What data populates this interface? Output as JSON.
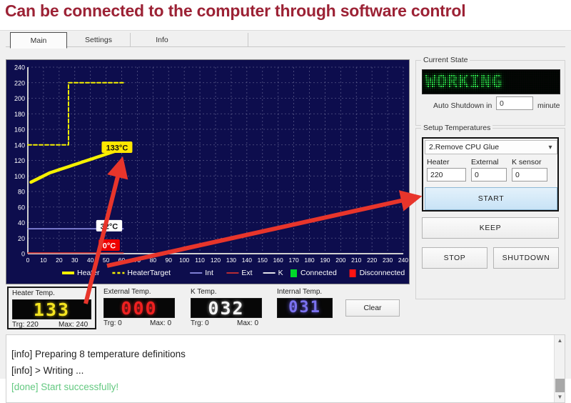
{
  "banner": {
    "text": "Can be connected to the computer through software control"
  },
  "tabs": [
    {
      "label": "Main",
      "selected": true
    },
    {
      "label": "Settings",
      "selected": false
    },
    {
      "label": "Info",
      "selected": false
    },
    {
      "label": "",
      "selected": false
    }
  ],
  "current_state": {
    "title": "Current State",
    "status_text": "WORKING",
    "status_color": "#2ce24a",
    "auto_shutdown_label": "Auto Shutdown in",
    "auto_shutdown_value": "0",
    "auto_shutdown_unit": "minute"
  },
  "setup": {
    "title": "Setup Temperatures",
    "profile_selected": "2.Remove CPU Glue",
    "chevron": "chevron-down-icon",
    "fields": [
      {
        "label": "Heater",
        "value": "220"
      },
      {
        "label": "External",
        "value": "0"
      },
      {
        "label": "K sensor",
        "value": "0"
      }
    ],
    "start_label": "START",
    "keep_label": "KEEP",
    "stop_label": "STOP",
    "shutdown_label": "SHUTDOWN"
  },
  "readouts": [
    {
      "caption": "Heater Temp.",
      "value": "133",
      "color": "#f4e420",
      "trg": "Trg: 220",
      "max": "Max: 240",
      "highlighted": true
    },
    {
      "caption": "External Temp.",
      "value": "000",
      "color": "#f02020",
      "trg": "Trg: 0",
      "max": "Max: 0",
      "highlighted": false
    },
    {
      "caption": "K Temp.",
      "value": "032",
      "color": "#f4f4f4",
      "trg": "Trg: 0",
      "max": "Max: 0",
      "highlighted": false
    },
    {
      "caption": "Internal Temp.",
      "value": "031",
      "color": "#7b72f0",
      "trg": "",
      "max": "",
      "highlighted": false
    }
  ],
  "clear_button": {
    "label": "Clear"
  },
  "log": {
    "lines": [
      {
        "text": "[info] Preparing 8 temperature definitions",
        "color": "#1f1f1f"
      },
      {
        "text": "[info] > Writing ...",
        "color": "#1f1f1f"
      },
      {
        "text": "[done] Start successfully!",
        "color": "#64c981"
      }
    ]
  },
  "chart_data": {
    "type": "line",
    "title": "",
    "xlabel": "",
    "ylabel": "",
    "xlim": [
      0,
      240
    ],
    "ylim": [
      0,
      240
    ],
    "xticks": [
      0,
      10,
      20,
      30,
      40,
      50,
      60,
      70,
      80,
      90,
      100,
      110,
      120,
      130,
      140,
      150,
      160,
      170,
      180,
      190,
      200,
      210,
      220,
      230,
      240
    ],
    "yticks": [
      0,
      20,
      40,
      60,
      80,
      100,
      120,
      140,
      160,
      180,
      200,
      220,
      240
    ],
    "grid": true,
    "background": "#0d0d4d",
    "grid_color": "#6f6f9a",
    "axis_color": "#cfcfcf",
    "legend_position": "bottom",
    "legend": [
      {
        "name": "Heater",
        "color": "#f5f000",
        "style": "solid-thick"
      },
      {
        "name": "HeaterTarget",
        "color": "#f5f000",
        "style": "dashed"
      },
      {
        "name": "Int",
        "color": "#8f8fe8",
        "style": "solid"
      },
      {
        "name": "Ext",
        "color": "#cf3030",
        "style": "solid"
      },
      {
        "name": "K",
        "color": "#ffffff",
        "style": "solid"
      },
      {
        "name": "Connected",
        "color": "#00d82a",
        "style": "swatch"
      },
      {
        "name": "Disconnected",
        "color": "#ff1414",
        "style": "swatch"
      }
    ],
    "annotations": [
      {
        "text": "133°C",
        "x": 57,
        "y": 137,
        "bg": "#ffe800",
        "fg": "#111111"
      },
      {
        "text": "32°C",
        "x": 52,
        "y": 36,
        "bg": "#ffffff",
        "fg": "#111111"
      },
      {
        "text": "0°C",
        "x": 52,
        "y": 11,
        "bg": "#ee0000",
        "fg": "#ffffff"
      }
    ],
    "series": [
      {
        "name": "Heater",
        "color": "#f5f000",
        "style": "solid-thick",
        "x": [
          2,
          5,
          8,
          11,
          14,
          17,
          20,
          23,
          26,
          29,
          32,
          35,
          38,
          41,
          44,
          47,
          50,
          53,
          56,
          59,
          61
        ],
        "y": [
          92,
          95,
          98,
          101,
          104,
          106,
          108,
          110,
          112,
          114,
          116,
          118,
          120,
          122,
          124,
          126,
          128,
          130,
          132,
          133,
          133
        ]
      },
      {
        "name": "HeaterTarget",
        "color": "#f5f000",
        "style": "dashed",
        "x": [
          0,
          26,
          26,
          61
        ],
        "y": [
          140,
          140,
          220,
          220
        ]
      },
      {
        "name": "Int",
        "color": "#8f8fe8",
        "style": "solid",
        "x": [
          0,
          61
        ],
        "y": [
          32,
          32
        ]
      },
      {
        "name": "Ext",
        "color": "#cf3030",
        "style": "solid",
        "x": [
          0,
          61
        ],
        "y": [
          1,
          1
        ]
      },
      {
        "name": "K",
        "color": "#ffffff",
        "style": "solid",
        "x": [],
        "y": []
      }
    ]
  },
  "annotation_arrows": [
    {
      "name": "arrow-to-chart-heater",
      "from": [
        120,
        425
      ],
      "to": [
        168,
        235
      ]
    },
    {
      "name": "arrow-to-start-button",
      "from": [
        150,
        372
      ],
      "to": [
        575,
        278
      ]
    }
  ]
}
